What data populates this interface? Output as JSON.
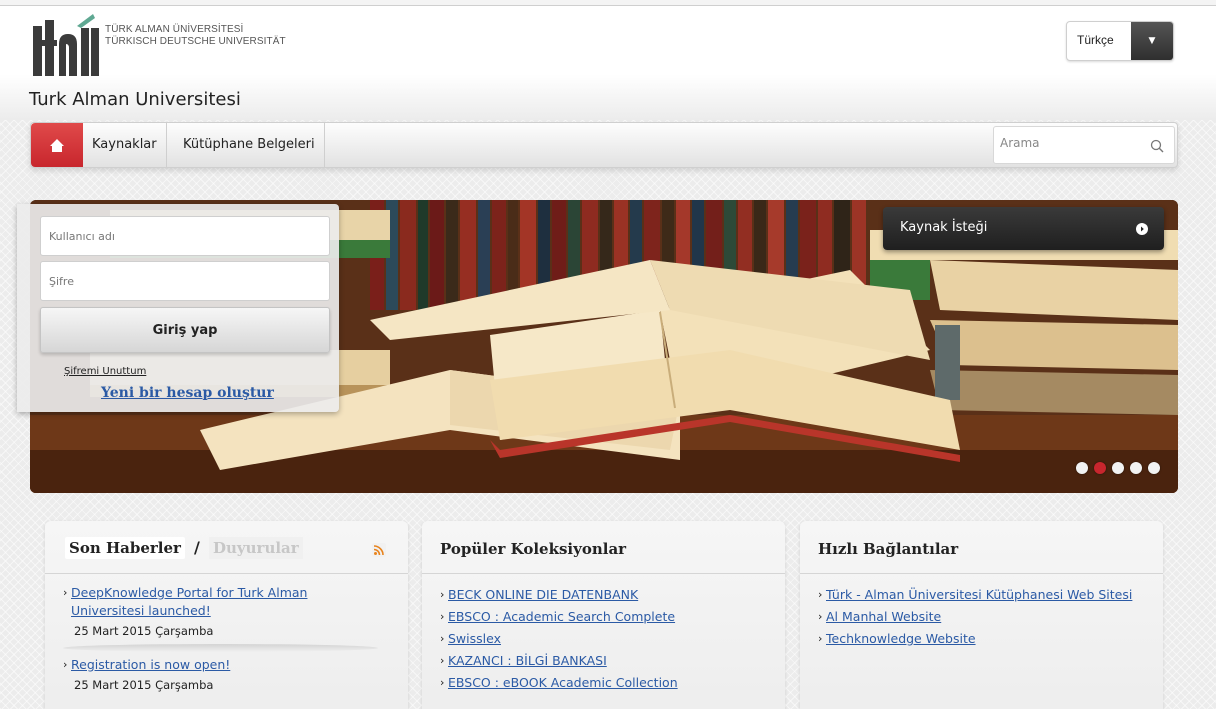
{
  "header": {
    "logo_text_line1": "TÜRK ALMAN ÜNİVERSİTESİ",
    "logo_text_line2": "TÜRKISCH DEUTSCHE UNIVERSITÄT",
    "site_title": "Turk Alman Universitesi",
    "language": "Türkçe"
  },
  "nav": {
    "items": [
      "Kaynaklar",
      "Kütüphane Belgeleri"
    ],
    "search_placeholder": "Arama"
  },
  "login": {
    "username_placeholder": "Kullanıcı adı",
    "password_placeholder": "Şifre",
    "submit_label": "Giriş yap",
    "forgot_label": "Şifremi Unuttum",
    "register_label": "Yeni bir hesap oluştur"
  },
  "banner": {
    "request_label": "Kaynak İsteği",
    "slide_count": 5,
    "active_slide": 2
  },
  "news": {
    "tab_news": "Son Haberler",
    "tab_separator": "/",
    "tab_announcements": "Duyurular",
    "items": [
      {
        "title": "DeepKnowledge Portal for Turk Alman Universitesi launched!",
        "date": "25 Mart 2015 Çarşamba"
      },
      {
        "title": "Registration is now open!",
        "date": "25 Mart 2015 Çarşamba"
      }
    ]
  },
  "collections": {
    "title": "Popüler Koleksiyonlar",
    "items": [
      "BECK ONLINE DIE DATENBANK",
      "EBSCO : Academic Search Complete",
      "Swisslex",
      "KAZANCI : BİLGİ BANKASI",
      "EBSCO : eBOOK Academic Collection"
    ]
  },
  "quicklinks": {
    "title": "Hızlı Bağlantılar",
    "items": [
      "Türk - Alman Üniversitesi Kütüphanesi Web Sitesi",
      "Al Manhal Website",
      "Techknowledge Website"
    ]
  },
  "colors": {
    "accent_red": "#c8262d",
    "link_blue": "#2b5aa5",
    "dark_button": "#2f2f2f"
  }
}
